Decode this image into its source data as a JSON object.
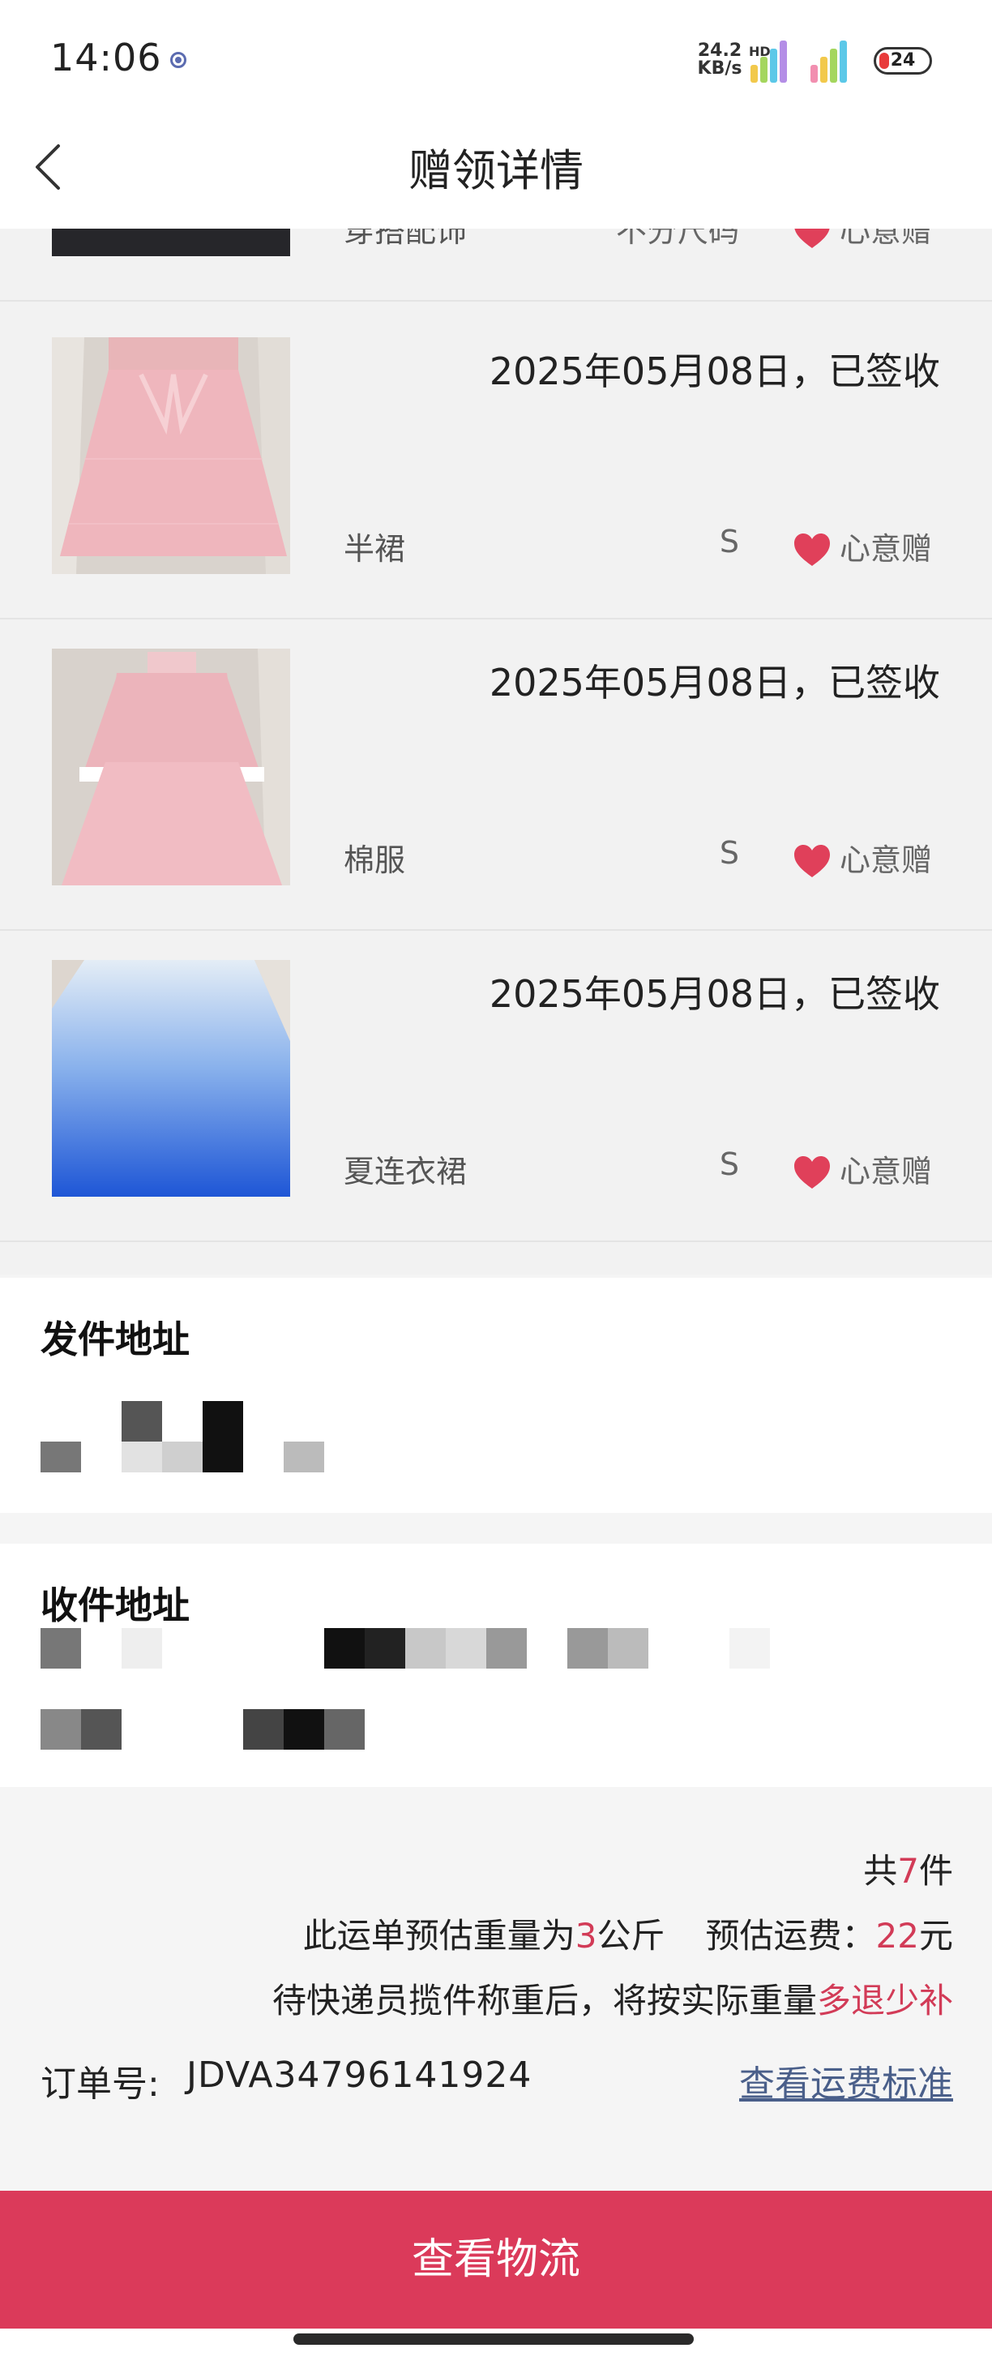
{
  "status_bar": {
    "time": "14:06",
    "net_speed_value": "24.2",
    "net_speed_unit": "KB/s",
    "hd_label": "HD",
    "battery": "24"
  },
  "nav": {
    "title": "赠领详情",
    "back_icon": "chevron-left-icon"
  },
  "items": [
    {
      "name": "穿搭配饰",
      "size": "不分尺码",
      "gift_label": "心意赠",
      "date_status": ""
    },
    {
      "name": "半裙",
      "size": "S",
      "gift_label": "心意赠",
      "date_status": "2025年05月08日，已签收"
    },
    {
      "name": "棉服",
      "size": "S",
      "gift_label": "心意赠",
      "date_status": "2025年05月08日，已签收"
    },
    {
      "name": "夏连衣裙",
      "size": "S",
      "gift_label": "心意赠",
      "date_status": "2025年05月08日，已签收"
    }
  ],
  "sender": {
    "title": "发件地址"
  },
  "receiver": {
    "title": "收件地址"
  },
  "summary": {
    "total_prefix": "共",
    "total_count": "7",
    "total_suffix": "件",
    "weight_prefix": "此运单预估重量为",
    "weight_value": "3",
    "weight_unit": "公斤",
    "fee_label": "预估运费：",
    "fee_value": "22",
    "fee_unit": "元",
    "note_prefix": "待快递员揽件称重后，将按实际重量",
    "note_accent": "多退少补",
    "order_label": "订单号:",
    "order_number": "JDVA34796141924",
    "fee_standard_link": "查看运费标准"
  },
  "bottom_button": "查看物流",
  "colors": {
    "accent": "#d23b57",
    "button": "#db3a5a",
    "heart": "#e0405a",
    "link": "#4a5f8a"
  }
}
